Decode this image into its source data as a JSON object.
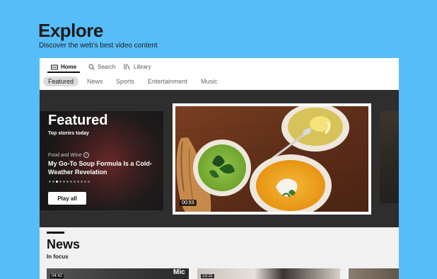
{
  "header": {
    "title": "Explore",
    "subtitle": "Discover the web's best video content"
  },
  "topnav": [
    {
      "label": "Home",
      "icon": "home-icon",
      "active": true
    },
    {
      "label": "Search",
      "icon": "search-icon"
    },
    {
      "label": "Library",
      "icon": "library-icon"
    }
  ],
  "categories": [
    "Featured",
    "News",
    "Sports",
    "Entertainment",
    "Music"
  ],
  "featured": {
    "heading": "Featured",
    "subheading": "Top stories today",
    "source": "Food and Wine",
    "story_title": "My Go-To Soup Formula Is a Cold-Weather Revelation",
    "play_label": "Play all",
    "duration": "00:53",
    "carousel_count": 12,
    "carousel_active": 2
  },
  "news": {
    "heading": "News",
    "subheading": "In focus",
    "thumbs": [
      {
        "duration": "04:42",
        "overlay": "Mic"
      },
      {
        "duration": "13:11",
        "overlay": ""
      }
    ]
  },
  "colors": {
    "background": "#56bdf8",
    "featured_bg": "#2e2e2e",
    "soup_green": "#7db23a",
    "soup_yellow": "#f0a51b"
  }
}
